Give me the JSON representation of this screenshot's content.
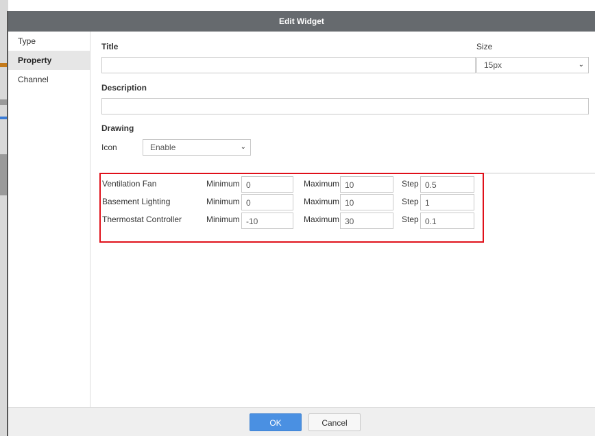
{
  "dialog": {
    "title": "Edit Widget"
  },
  "sidebar": {
    "items": [
      {
        "label": "Type"
      },
      {
        "label": "Property"
      },
      {
        "label": "Channel"
      }
    ],
    "active_index": 1
  },
  "form": {
    "title_label": "Title",
    "title_value": "",
    "size_label": "Size",
    "size_value": "15px",
    "description_label": "Description",
    "description_value": "",
    "drawing_label": "Drawing",
    "icon_label": "Icon",
    "icon_value": "Enable"
  },
  "channels": {
    "min_label": "Minimum",
    "max_label": "Maximum",
    "step_label": "Step",
    "rows": [
      {
        "name": "Ventilation Fan",
        "min": "0",
        "max": "10",
        "step": "0.5"
      },
      {
        "name": "Basement Lighting",
        "min": "0",
        "max": "10",
        "step": "1"
      },
      {
        "name": "Thermostat Controller",
        "min": "-10",
        "max": "30",
        "step": "0.1"
      }
    ]
  },
  "footer": {
    "ok_label": "OK",
    "cancel_label": "Cancel"
  },
  "colors": {
    "titlebar": "#666a6e",
    "highlight_box": "#e0101a",
    "ok_button": "#4a90e2"
  }
}
